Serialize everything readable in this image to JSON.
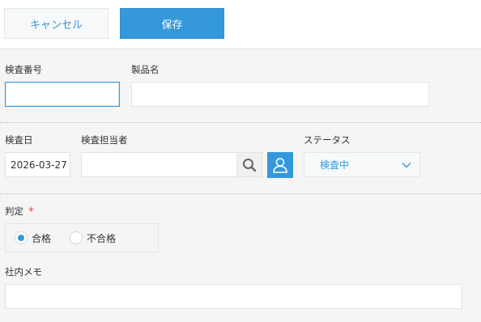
{
  "toolbar": {
    "cancel_label": "キャンセル",
    "save_label": "保存"
  },
  "form": {
    "inspection_number": {
      "label": "検査番号",
      "value": ""
    },
    "product_name": {
      "label": "製品名",
      "value": ""
    },
    "inspection_date": {
      "label": "検査日",
      "value": "2026-03-27"
    },
    "inspector": {
      "label": "検査担当者",
      "value": "",
      "search_icon": "search-icon",
      "user_icon": "user-icon"
    },
    "status": {
      "label": "ステータス",
      "selected": "検査中"
    },
    "judgement": {
      "label": "判定",
      "required_mark": "*",
      "options": [
        {
          "label": "合格",
          "checked": true
        },
        {
          "label": "不合格",
          "checked": false
        }
      ]
    },
    "internal_memo": {
      "label": "社内メモ",
      "value": ""
    }
  },
  "colors": {
    "accent": "#3498db",
    "required": "#e74c3c",
    "background": "#f5f5f5"
  }
}
